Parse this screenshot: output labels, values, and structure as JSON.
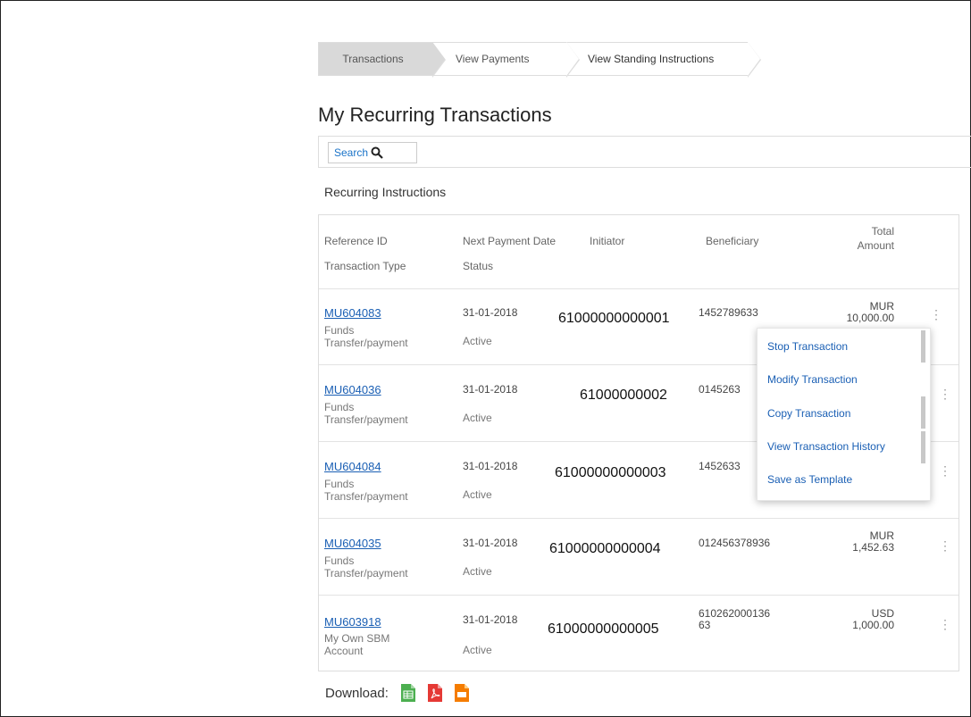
{
  "breadcrumb": [
    "Transactions",
    "View Payments",
    "View Standing Instructions"
  ],
  "page_title": "My Recurring Transactions",
  "search": {
    "label": "Search"
  },
  "section_title": "Recurring Instructions",
  "columns": {
    "ref_id": "Reference ID",
    "txn_type": "Transaction Type",
    "next_date": "Next Payment Date",
    "status": "Status",
    "initiator": "Initiator",
    "beneficiary": "Beneficiary",
    "total": "Total",
    "amount": "Amount"
  },
  "rows": [
    {
      "ref": "MU604083",
      "type_l1": "Funds",
      "type_l2": "Transfer/payment",
      "date": "31-01-2018",
      "status": "Active",
      "initiator": "61000000000001",
      "beneficiary": "1452789633",
      "ben_l2": "",
      "cur": "MUR",
      "amount": "10,000.00"
    },
    {
      "ref": "MU604036",
      "type_l1": "Funds",
      "type_l2": "Transfer/payment",
      "date": "31-01-2018",
      "status": "Active",
      "initiator": "61000000002",
      "beneficiary": "0145263",
      "ben_l2": "",
      "cur": "",
      "amount": ""
    },
    {
      "ref": "MU604084",
      "type_l1": "Funds",
      "type_l2": "Transfer/payment",
      "date": "31-01-2018",
      "status": "Active",
      "initiator": "61000000000003",
      "beneficiary": "1452633",
      "ben_l2": "",
      "cur": "",
      "amount": ""
    },
    {
      "ref": "MU604035",
      "type_l1": "Funds",
      "type_l2": "Transfer/payment",
      "date": "31-01-2018",
      "status": "Active",
      "initiator": "61000000000004",
      "beneficiary": "012456378936",
      "ben_l2": "",
      "cur": "MUR",
      "amount": "1,452.63"
    },
    {
      "ref": "MU603918",
      "type_l1": "My Own SBM",
      "type_l2": "Account",
      "date": "31-01-2018",
      "status": "Active",
      "initiator": "61000000000005",
      "beneficiary": "610262000136",
      "ben_l2": "63",
      "cur": "USD",
      "amount": "1,000.00"
    }
  ],
  "menu": [
    "Stop Transaction",
    "Modify Transaction",
    "Copy Transaction",
    "View Transaction History",
    "Save as Template"
  ],
  "download": {
    "label": "Download:",
    "icons": [
      "excel-icon",
      "pdf-icon",
      "file-icon"
    ]
  },
  "colors": {
    "link": "#1a5fb4",
    "excel": "#4caf50",
    "pdf": "#e53935",
    "file": "#f57c00",
    "crumb_active": "#d9d9d9"
  }
}
